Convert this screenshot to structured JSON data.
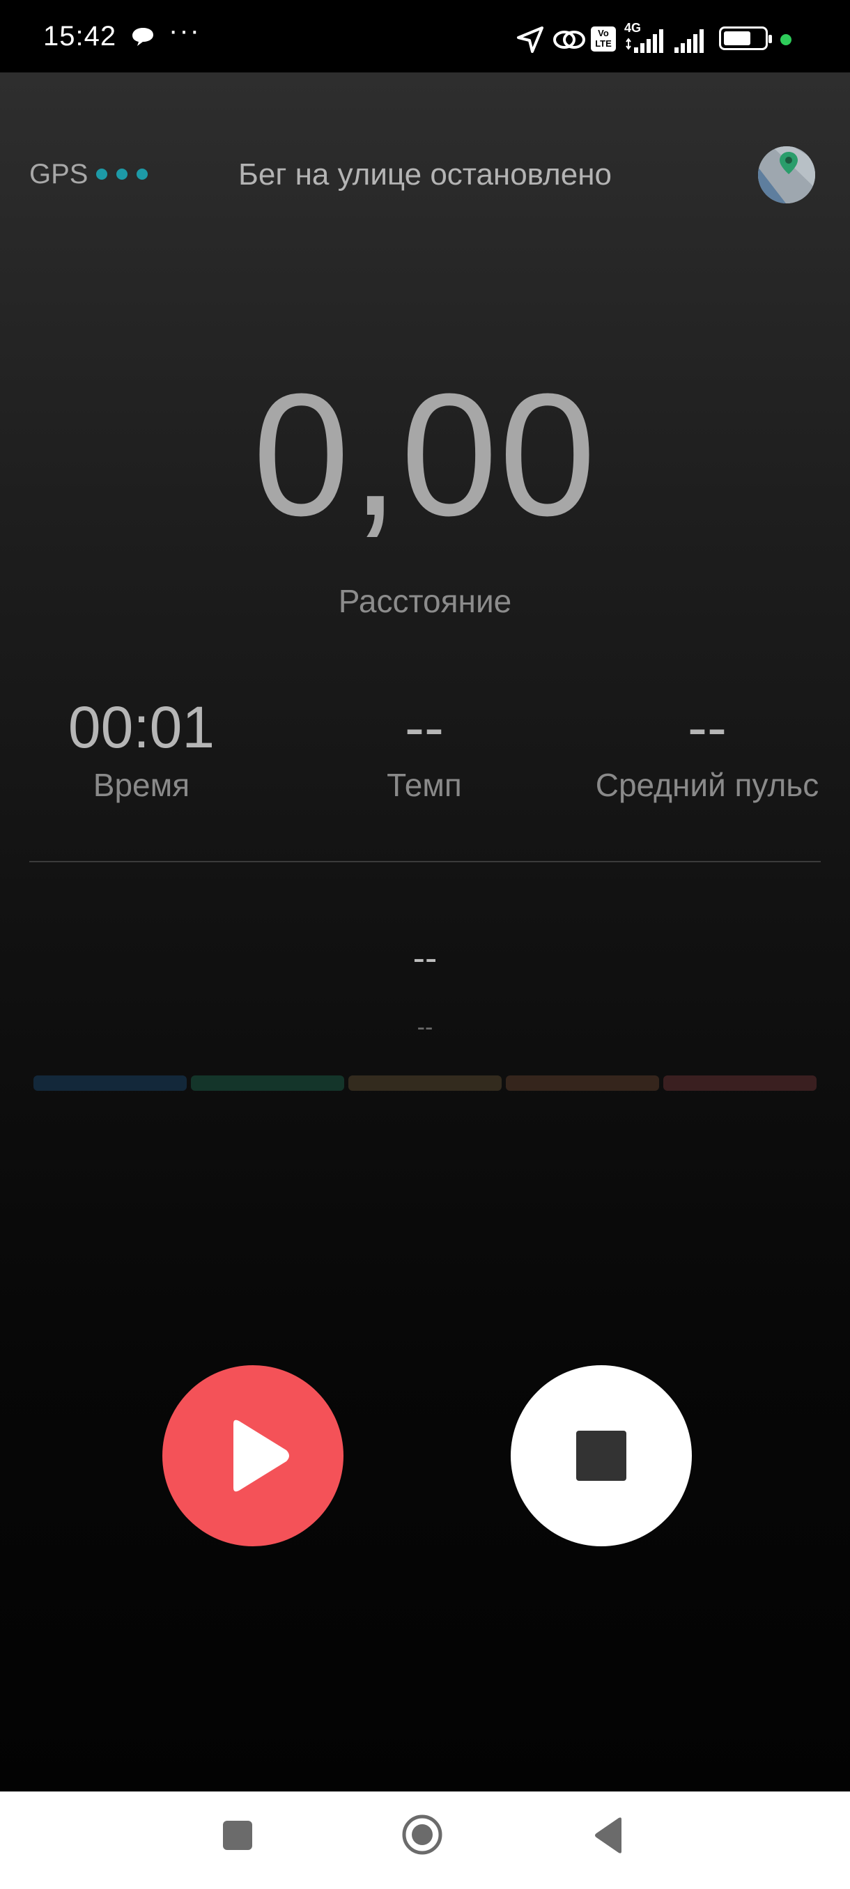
{
  "status_bar": {
    "time": "15:42",
    "more": "···",
    "battery": "70",
    "network": "4G",
    "volte": "Vo LTE"
  },
  "header": {
    "gps_label": "GPS",
    "title": "Бег на улице остановлено"
  },
  "distance": {
    "value": "0,00",
    "label": "Расстояние"
  },
  "stats": [
    {
      "value": "00:01",
      "label": "Время"
    },
    {
      "value": "--",
      "label": "Темп"
    },
    {
      "value": "--",
      "label": "Средний пульс"
    }
  ],
  "heart_rate": {
    "value": "--",
    "sub": "--"
  },
  "zone_colors": [
    "#13283a",
    "#14352a",
    "#332b1e",
    "#35251c",
    "#3a1f20"
  ],
  "colors": {
    "accent_gps": "#1d9aa7",
    "play": "#f45258",
    "stop": "#ffffff"
  }
}
